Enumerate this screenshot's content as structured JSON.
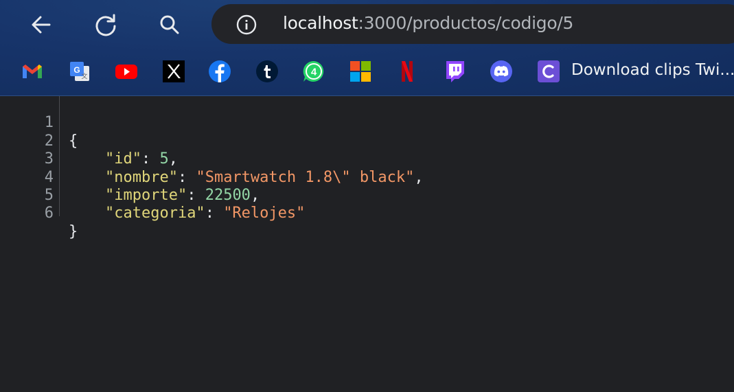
{
  "address_bar": {
    "host": "localhost",
    "path": ":3000/productos/codigo/5"
  },
  "icons": {
    "back": "back-arrow-icon",
    "reload": "reload-icon",
    "search": "search-icon",
    "site_info": "info-icon"
  },
  "bookmarks": [
    {
      "icon": "gmail-icon"
    },
    {
      "icon": "google-translate-icon"
    },
    {
      "icon": "youtube-icon"
    },
    {
      "icon": "x-icon"
    },
    {
      "icon": "facebook-icon"
    },
    {
      "icon": "tumblr-icon"
    },
    {
      "icon": "whatsapp-icon"
    },
    {
      "icon": "microsoft-icon"
    },
    {
      "icon": "netflix-icon"
    },
    {
      "icon": "twitch-icon"
    },
    {
      "icon": "discord-icon"
    },
    {
      "icon": "clipchamp-icon",
      "label": "Download clips Twi..."
    }
  ],
  "json": {
    "lines": [
      {
        "n": "1",
        "open": "{"
      },
      {
        "n": "2",
        "key": "\"id\"",
        "value": "5",
        "type": "num",
        "comma": ","
      },
      {
        "n": "3",
        "key": "\"nombre\"",
        "value": "\"Smartwatch 1.8\\\" black\"",
        "type": "str",
        "comma": ","
      },
      {
        "n": "4",
        "key": "\"importe\"",
        "value": "22500",
        "type": "num",
        "comma": ","
      },
      {
        "n": "5",
        "key": "\"categoria\"",
        "value": "\"Relojes\"",
        "type": "str",
        "comma": ""
      },
      {
        "n": "6",
        "open": "}"
      }
    ]
  },
  "colors": {
    "toolbar_bg": "#17346a",
    "editor_bg": "#202124",
    "key": "#e0d67a",
    "number": "#93d6a6",
    "string": "#f29766"
  }
}
